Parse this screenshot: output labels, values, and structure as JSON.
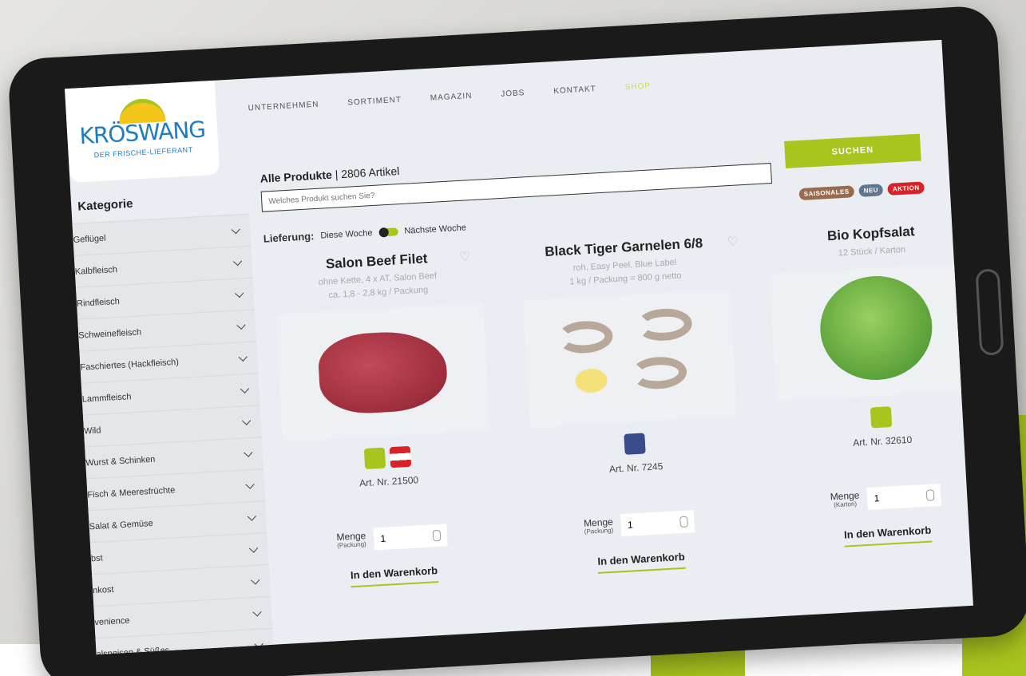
{
  "header": {
    "logo_name": "KRÖSWANG",
    "logo_tagline": "DER FRISCHE-LIEFERANT",
    "nav": [
      "UNTERNEHMEN",
      "SORTIMENT",
      "MAGAZIN",
      "JOBS",
      "KONTAKT",
      "SHOP"
    ],
    "active_nav": "SHOP"
  },
  "sidebar": {
    "title": "Kategorie",
    "items": [
      {
        "label": "Geflügel"
      },
      {
        "label": "Kalbfleisch"
      },
      {
        "label": "Rindfleisch"
      },
      {
        "label": "Schweinefleisch"
      },
      {
        "label": "Faschiertes (Hackfleisch)"
      },
      {
        "label": "Lammfleisch"
      },
      {
        "label": "Wild"
      },
      {
        "label": "Wurst & Schinken"
      },
      {
        "label": "Fisch & Meeresfrüchte"
      },
      {
        "label": "Salat & Gemüse"
      },
      {
        "label": "bst"
      },
      {
        "label": "nkost"
      },
      {
        "label": "venience"
      },
      {
        "label": "alspeisen & Süßes"
      }
    ]
  },
  "main": {
    "results_title": "Alle Produkte",
    "results_count": "| 2806 Artikel",
    "search_placeholder": "Welches Produkt suchen Sie?",
    "search_button": "SUCHEN",
    "badges": [
      {
        "label": "SAISONALES",
        "color": "#9a6a4e"
      },
      {
        "label": "NEU",
        "color": "#5e7690"
      },
      {
        "label": "AKTION",
        "color": "#d8222a"
      }
    ],
    "delivery_label": "Lieferung:",
    "delivery_this_week": "Diese Woche",
    "delivery_next_week": "Nächste Woche"
  },
  "products": [
    {
      "name": "Salon Beef Filet",
      "desc1": "ohne Kette, 4 x AT, Salon Beef",
      "desc2": "ca. 1,8 - 2,8 kg / Packung",
      "art": "Art. Nr. 21500",
      "qty_label": "Menge",
      "qty_unit": "(Packung)",
      "qty_value": "1",
      "cart": "In den Warenkorb"
    },
    {
      "name": "Black Tiger Garnelen 6/8",
      "desc1": "roh, Easy Peel, Blue Label",
      "desc2": "1 kg / Packung = 800 g netto",
      "art": "Art. Nr. 7245",
      "qty_label": "Menge",
      "qty_unit": "(Packung)",
      "qty_value": "1",
      "cart": "In den Warenkorb"
    },
    {
      "name": "Bio Kopfsalat",
      "desc1": "12 Stück / Karton",
      "desc2": "",
      "art": "Art. Nr. 32610",
      "qty_label": "Menge",
      "qty_unit": "(Karton)",
      "qty_value": "1",
      "cart": "In den Warenkorb"
    }
  ],
  "colors": {
    "accent": "#a8c41e",
    "brand_blue": "#1f7cc1"
  }
}
